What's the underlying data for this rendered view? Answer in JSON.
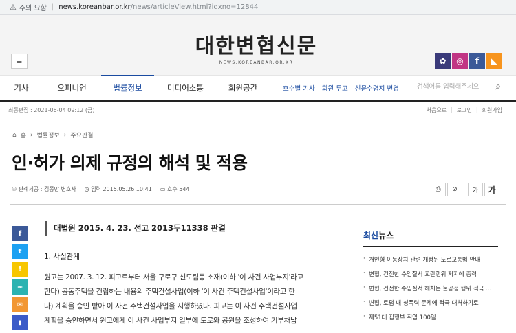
{
  "browser": {
    "security_label": "주의 요함",
    "url_host": "news.koreanbar.or.kr",
    "url_path": "/news/articleView.html?idxno=12844"
  },
  "header": {
    "logo_text": "대한변협신문",
    "logo_sub": "NEWS.KOREANBAR.OR.KR",
    "sns": [
      {
        "icon": "bar-emblem-icon",
        "color": "#3a3a7a",
        "glyph": "✿"
      },
      {
        "icon": "instagram-icon",
        "color": "#c13584",
        "glyph": "◎"
      },
      {
        "icon": "facebook-icon",
        "color": "#3b5998",
        "glyph": "f"
      },
      {
        "icon": "rss-icon",
        "color": "#f7941d",
        "glyph": "◣"
      }
    ]
  },
  "nav": {
    "items": [
      "기사",
      "오피니언",
      "법률정보",
      "미디어소통",
      "회원공간"
    ],
    "active_index": 2,
    "sub_links": [
      "호수별 기사",
      "회원 투고",
      "신문수령지 변경"
    ],
    "search_placeholder": "검색어를 입력해주세요"
  },
  "infobar": {
    "updated": "최종편집 : 2021-06-04 09:12 (금)",
    "links": [
      "처음으로",
      "로그인",
      "회원가입"
    ]
  },
  "breadcrumb": [
    "홈",
    "법률정보",
    "주요판결"
  ],
  "article": {
    "title": "인·허가 의제 규정의 해석 및 적용",
    "author": "판례제공 : 김종만 변호사",
    "date": "입력 2015.05.26 10:41",
    "issue": "호수 544",
    "quote": "대법원 2015. 4. 23. 선고 2013두11338 판결",
    "section": "1. 사실관계",
    "paragraph_lines": [
      "원고는 2007. 3. 12. 피고로부터 서울 구로구 신도림동 소재(이하 '이 사건 사업부지'라고",
      "한다) 공동주택을 건립하는 내용의 주택건설사업(이하 '이 사건 주택건설사업'이라고 한",
      "다) 계획을 승인 받아 이 사건 주택건설사업을 시행하였다. 피고는 이 사건 주택건설사업",
      "계획을 승인하면서 원고에게 이 사건 사업부지 일부에 도로와 공원을 조성하여 기부채납"
    ]
  },
  "tools": {
    "print": "⎙",
    "link": "⊘",
    "font_small": "가",
    "font_big": "가"
  },
  "share": [
    {
      "icon": "facebook-icon",
      "color": "#3b5998",
      "glyph": "f"
    },
    {
      "icon": "twitter-icon",
      "color": "#1da1f2",
      "glyph": "t"
    },
    {
      "icon": "kakaostory-icon",
      "color": "#f7c600",
      "glyph": "!"
    },
    {
      "icon": "link-icon",
      "color": "#2cb3b1",
      "glyph": "∞"
    },
    {
      "icon": "email-icon",
      "color": "#f29733",
      "glyph": "✉"
    },
    {
      "icon": "bookmark-icon",
      "color": "#3b5bc8",
      "glyph": "▮"
    }
  ],
  "sidebar": {
    "title_accent": "최신",
    "title_rest": "뉴스",
    "items": [
      "개인형 이동장치 관련 개정된 도로교통법 안내",
      "변협, 건전한 수임질서 교란행위 저지에 총력",
      "변협, 건전한 수임질서 해치는 불공정 행위 적극 ...",
      "변협, 로펌 내 성폭력 문제에 적극 대처하기로",
      "제51대 집행부 취임 100일"
    ]
  }
}
